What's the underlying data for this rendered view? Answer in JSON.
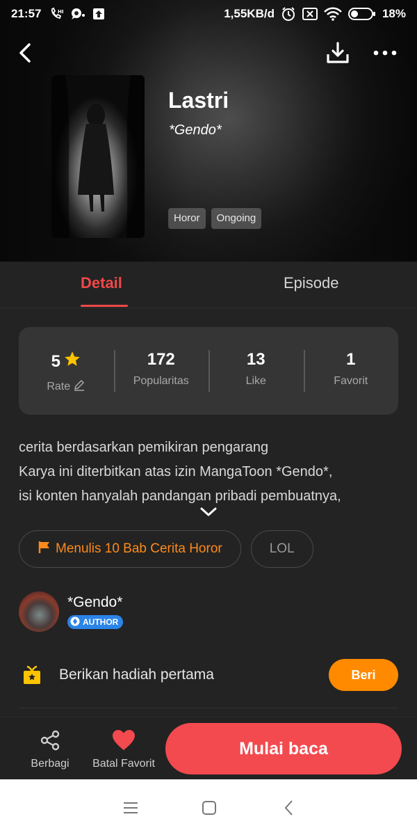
{
  "status_bar": {
    "time": "21:57",
    "network_speed": "1,55KB/d",
    "battery": "18%",
    "icons": [
      "call-icon",
      "chat-icon",
      "upload-icon",
      "alarm-icon",
      "sim-x-icon",
      "wifi-icon",
      "battery-icon"
    ]
  },
  "header": {
    "back_icon": "back-arrow-icon",
    "download_icon": "download-icon",
    "more_icon": "more-dots-icon"
  },
  "book": {
    "title": "Lastri",
    "author": "*Gendo*",
    "tags": [
      "Horor",
      "Ongoing"
    ]
  },
  "tabs": {
    "detail": "Detail",
    "episode": "Episode",
    "active": "Detail",
    "accent": "#f04848"
  },
  "stats": {
    "rate": {
      "value": "5",
      "label": "Rate"
    },
    "popularity": {
      "value": "172",
      "label": "Popularitas"
    },
    "like": {
      "value": "13",
      "label": "Like"
    },
    "favorite": {
      "value": "1",
      "label": "Favorit"
    }
  },
  "description": {
    "line1": "cerita berdasarkan pemikiran pengarang",
    "line2": "Karya ini diterbitkan atas izin MangaToon *Gendo*,",
    "line3": "isi konten hanyalah pandangan pribadi pembuatnya,"
  },
  "chips": {
    "challenge": "Menulis 10 Bab Cerita Horor",
    "other": "LOL"
  },
  "author_card": {
    "name": "*Gendo*",
    "badge": "AUTHOR",
    "badge_color": "#2b84e8"
  },
  "gift": {
    "text": "Berikan hadiah pertama",
    "button": "Beri",
    "button_color": "#ff8a00"
  },
  "action_bar": {
    "share": "Berbagi",
    "unfavorite": "Batal Favorit",
    "read": "Mulai baca",
    "read_color": "#f24a4f"
  },
  "nav_bar": {
    "menu_icon": "menu-icon",
    "home_icon": "home-square-icon",
    "back_icon": "nav-back-icon"
  }
}
